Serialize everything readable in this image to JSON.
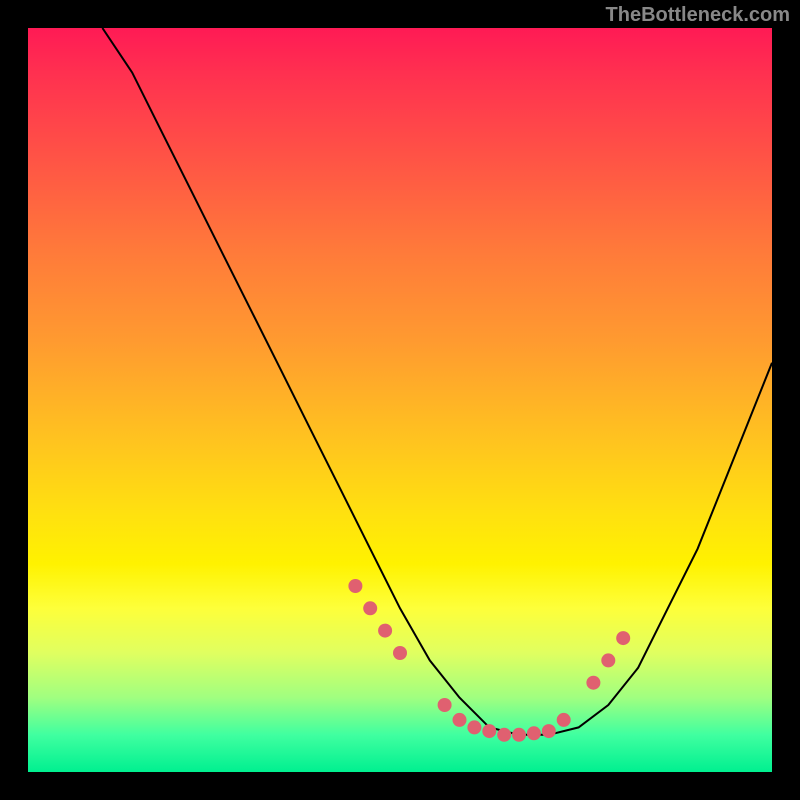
{
  "watermark": "TheBottleneck.com",
  "chart_data": {
    "type": "line",
    "title": "",
    "xlabel": "",
    "ylabel": "",
    "xlim": [
      0,
      100
    ],
    "ylim": [
      0,
      100
    ],
    "curve": {
      "x": [
        10,
        14,
        18,
        22,
        26,
        30,
        34,
        38,
        42,
        46,
        50,
        54,
        58,
        62,
        66,
        70,
        74,
        78,
        82,
        86,
        90,
        94,
        98,
        100
      ],
      "y": [
        100,
        94,
        86,
        78,
        70,
        62,
        54,
        46,
        38,
        30,
        22,
        15,
        10,
        6,
        5,
        5,
        6,
        9,
        14,
        22,
        30,
        40,
        50,
        55
      ]
    },
    "markers": {
      "x": [
        44,
        46,
        48,
        50,
        56,
        58,
        60,
        62,
        64,
        66,
        68,
        70,
        72,
        76,
        78,
        80
      ],
      "y": [
        25,
        22,
        19,
        16,
        9,
        7,
        6,
        5.5,
        5,
        5,
        5.2,
        5.5,
        7,
        12,
        15,
        18
      ],
      "color": "#e06070",
      "radius": 7
    }
  }
}
